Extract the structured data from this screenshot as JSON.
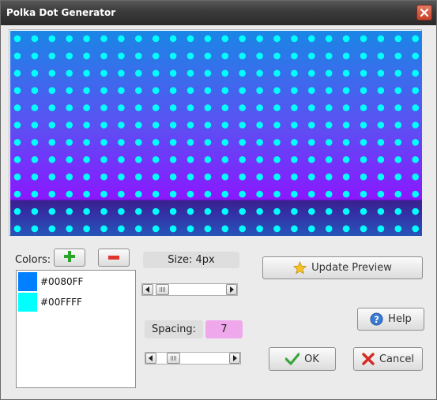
{
  "window": {
    "title": "Polka Dot Generator"
  },
  "preview": {
    "gradient_colors": [
      "#1985E8",
      "#7B1DFF",
      "#2A3FA3"
    ],
    "dot_color": "#00FFFF"
  },
  "colors": {
    "label": "Colors:",
    "items": [
      {
        "hex": "#0080FF",
        "label": "#0080FF"
      },
      {
        "hex": "#00FFFF",
        "label": "#00FFFF"
      }
    ]
  },
  "size": {
    "label": "Size: 4px"
  },
  "spacing": {
    "label": "Spacing:",
    "value": "7"
  },
  "buttons": {
    "update_preview": "Update Preview",
    "help": "Help",
    "ok": "OK",
    "cancel": "Cancel"
  },
  "icons": {
    "add": "plus-icon",
    "remove": "minus-icon",
    "update": "star-icon",
    "help": "question-icon",
    "ok": "checkmark-icon",
    "cancel": "x-icon",
    "close": "close-icon"
  }
}
